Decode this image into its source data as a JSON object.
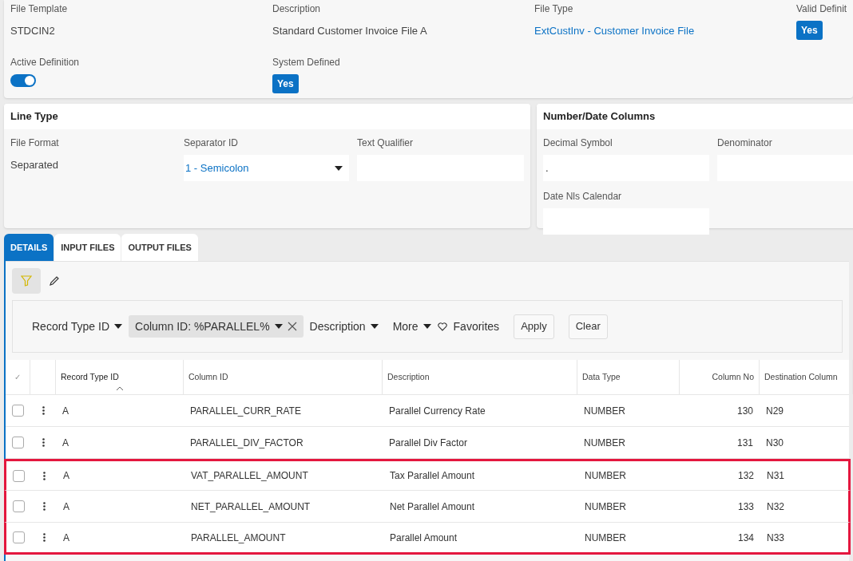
{
  "header": {
    "fields": [
      {
        "label": "File Template",
        "kind": "text",
        "value": "STDCIN2"
      },
      {
        "label": "Description",
        "kind": "text",
        "value": "Standard Customer Invoice File A"
      },
      {
        "label": "File Type",
        "kind": "link",
        "value": "ExtCustInv - Customer Invoice File"
      },
      {
        "label": "Valid Definit",
        "kind": "badge",
        "value": "Yes"
      },
      {
        "label": "Active Definition",
        "kind": "toggle",
        "on": true
      },
      {
        "label": "System Defined",
        "kind": "badge",
        "value": "Yes"
      }
    ]
  },
  "line_type": {
    "title": "Line Type",
    "fields": [
      {
        "label": "File Format",
        "kind": "text",
        "value": "Separated"
      },
      {
        "label": "Separator ID",
        "kind": "select",
        "value": "1 - Semicolon"
      },
      {
        "label": "Text Qualifier",
        "kind": "input"
      }
    ]
  },
  "number_date": {
    "title": "Number/Date Columns",
    "fields": [
      {
        "label": "Decimal Symbol",
        "kind": "input",
        "value": "."
      },
      {
        "label": "Denominator",
        "kind": "input"
      },
      {
        "label": "Date Nls Calendar",
        "kind": "input"
      }
    ]
  },
  "tabs": [
    {
      "label": "DETAILS",
      "selected": true
    },
    {
      "label": "INPUT FILES",
      "selected": false
    },
    {
      "label": "OUTPUT FILES",
      "selected": false
    }
  ],
  "filters": [
    {
      "label": "Record Type ID",
      "kind": "dropdown"
    },
    {
      "label": "Column ID: %PARALLEL%",
      "kind": "chip"
    },
    {
      "label": "Description",
      "kind": "dropdown"
    },
    {
      "label": "More",
      "kind": "dropdown"
    },
    {
      "label": "Favorites",
      "kind": "favorites"
    },
    {
      "label": "Apply",
      "kind": "button"
    },
    {
      "label": "Clear",
      "kind": "button"
    }
  ],
  "table": {
    "select_all": "✓",
    "columns": [
      {
        "label": "Record Type ID",
        "sorted": true
      },
      {
        "label": "Column ID",
        "sorted": false
      },
      {
        "label": "Description",
        "sorted": false
      },
      {
        "label": "Data Type",
        "sorted": false
      },
      {
        "label": "Column No",
        "sorted": false
      },
      {
        "label": "Destination Column",
        "sorted": false
      }
    ],
    "rows": [
      {
        "cells": [
          "A",
          "PARALLEL_CURR_RATE",
          "Parallel Currency Rate",
          "NUMBER",
          "130",
          "N29"
        ],
        "checked": false,
        "highlighted": false
      },
      {
        "cells": [
          "A",
          "PARALLEL_DIV_FACTOR",
          "Parallel Div Factor",
          "NUMBER",
          "131",
          "N30"
        ],
        "checked": false,
        "highlighted": false
      },
      {
        "cells": [
          "A",
          "VAT_PARALLEL_AMOUNT",
          "Tax Parallel Amount",
          "NUMBER",
          "132",
          "N31"
        ],
        "checked": false,
        "highlighted": true
      },
      {
        "cells": [
          "A",
          "NET_PARALLEL_AMOUNT",
          "Net Parallel Amount",
          "NUMBER",
          "133",
          "N32"
        ],
        "checked": false,
        "highlighted": true
      },
      {
        "cells": [
          "A",
          "PARALLEL_AMOUNT",
          "Parallel Amount",
          "NUMBER",
          "134",
          "N33"
        ],
        "checked": false,
        "highlighted": true
      }
    ]
  }
}
